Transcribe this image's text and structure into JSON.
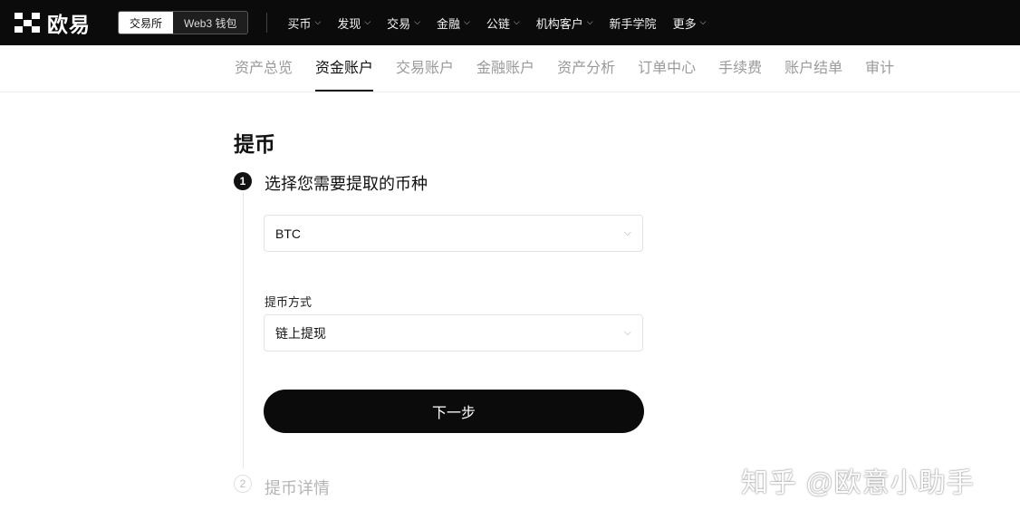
{
  "topbar": {
    "logo_text": "欧易",
    "switch": {
      "exchange": "交易所",
      "web3": "Web3 钱包"
    },
    "menu": [
      {
        "label": "买币",
        "chevron": true
      },
      {
        "label": "发现",
        "chevron": true
      },
      {
        "label": "交易",
        "chevron": true
      },
      {
        "label": "金融",
        "chevron": true
      },
      {
        "label": "公链",
        "chevron": true
      },
      {
        "label": "机构客户",
        "chevron": true
      },
      {
        "label": "新手学院",
        "chevron": false
      },
      {
        "label": "更多",
        "chevron": true
      }
    ]
  },
  "subnav": {
    "tabs": [
      "资产总览",
      "资金账户",
      "交易账户",
      "金融账户",
      "资产分析",
      "订单中心",
      "手续费",
      "账户结单",
      "审计"
    ],
    "active_index": 1
  },
  "withdraw": {
    "title": "提币",
    "step1": {
      "number": "1",
      "title": "选择您需要提取的币种"
    },
    "coin_value": "BTC",
    "method_label": "提币方式",
    "method_value": "链上提现",
    "next_label": "下一步",
    "step2": {
      "number": "2",
      "title": "提币详情"
    }
  },
  "watermark": "知乎 @欧意小助手",
  "colors": {
    "topbar_bg": "#0b0b0b",
    "button_bg": "#0b0b0b",
    "active_text": "#111111",
    "inactive_text": "#9a9a9a"
  }
}
